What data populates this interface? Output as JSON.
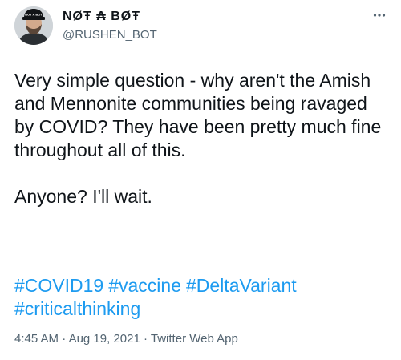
{
  "user": {
    "display_name": "NØŦ ₳ BØŦ",
    "handle": "@RUSHEN_BOT",
    "avatar_label": "NOT A BOT"
  },
  "more_icon": "more-horizontal-icon",
  "tweet": {
    "text": "Very simple question - why aren't the Amish and Mennonite communities being ravaged by COVID? They have been pretty much fine throughout all of this.\n\nAnyone? I'll wait.",
    "hashtags": [
      "#COVID19",
      "#vaccine",
      "#DeltaVariant",
      "#criticalthinking"
    ],
    "time": "4:45 AM",
    "separator": "·",
    "date": "Aug 19, 2021",
    "source": "Twitter Web App"
  },
  "colors": {
    "link": "#1d9bf0",
    "text": "#0f1419",
    "secondary": "#536471"
  }
}
